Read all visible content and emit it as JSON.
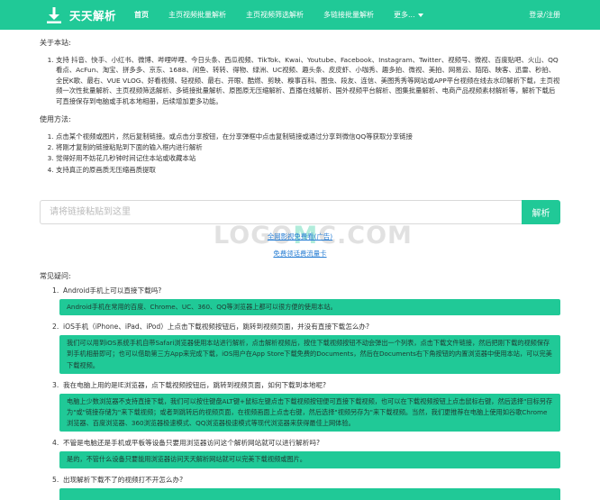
{
  "colors": {
    "brand": "#20c997",
    "link": "#2a7fd4"
  },
  "nav": {
    "brand_name": "天天解析",
    "brand_icon": "download-icon",
    "links": [
      "首页",
      "主页视频批量解析",
      "主页视频筛选解析",
      "多链接批量解析"
    ],
    "more_label": "更多...",
    "login_label": "登录/注册"
  },
  "about": {
    "title": "关于本站:",
    "items": [
      "支持 抖音、快手、小红书、微博、哔哩哔哩、今日头条、西瓜视频、TikTok、Kwai、Youtube、Facebook、Instagram、Twitter、视频号、微视、百度贴吧、火山、QQ看点、AcFun、淘宝、拼多多、京东、1688、闲鱼、转转、得物、绿洲、UC视频、趣头条、皮皮虾、小咖秀、趣多拍、微视、美拍、网易云、陌陌、映客、迅雷、秒拍、全民K歌、最右、VUE VLOG、好看视频、轻视频、最右、开眼、酷燃、剪映、糗事百科、图虫、段友、连信、美图秀秀等网站或APP平台视频在线去水印解析下载，主页视频一次性批量解析、主页视频筛选解析、多链接批量解析、原图原无压缩解析、直播在线解析、国外视频平台解析、图集批量解析、电商产品视频素材解析等，解析下载后可直接保存到电脑或手机本地相册，后续增加更多功能。"
    ]
  },
  "usage": {
    "title": "使用方法:",
    "items": [
      "点击某个视频或图片，然后复制链接。或点击分享按钮，在分享弹框中点击复制链接或通过分享到微信QQ等获取分享链接",
      "将刚才复制的链接粘贴到下面的输入框内进行解析",
      "觉得好用不妨花几秒钟时间记住本站或收藏本站",
      "支持真正的原画质无压缩画质提取"
    ]
  },
  "search": {
    "placeholder": "请将链接粘贴到这里",
    "button_label": "解析"
  },
  "links": {
    "video_link": "全网影视免费看(广告)",
    "traffic_link": "免费领话费流量卡"
  },
  "watermark": {
    "left": "LOGO",
    "mid": "M",
    "right": "C.COM"
  },
  "faq": {
    "title": "常见疑问:",
    "items": [
      {
        "q": "Android手机上可以直接下载吗?",
        "a": "Android手机在常用的百度、Chrome、UC、360、QQ等浏览器上都可以很方便的使用本站。"
      },
      {
        "q": "iOS手机（iPhone、iPad、iPod）上点击下载视频按钮后，跳转到视频页面，并没有直接下载怎么办?",
        "a": "我们可以用到iOS系统手机自带Safari浏览器使用本站进行解析，点击解析视频后，按住下载视频按钮不动会弹出一个列表，点击下载文件链接，然后把刚下载的视频保存到手机相册即可；也可以借助第三方App来完成下载，iOS用户在App Store下载免费的Documents，然后在Documents右下角按钮的内置浏览器中使用本站，可以完美下载视频。"
      },
      {
        "q": "我在电脑上用的是IE浏览器，点下载视频按钮后，跳转到视频页面，如何下载到本地呢?",
        "a": "电脑上少数浏览器不支持直接下载，我们可以按住键盘ALT键+鼠标左键点击下载视频按钮便可直接下载视频，也可以在下载视频按钮上点击鼠标右键，然后选择\"目标另存为\"或\"链接存储为\"来下载视频；或者到跳转后的视频页面，在视频画面上点击右键，然后选择\"视频另存为\"来下载视频。当然，我们更推荐在电脑上使用如谷歌Chrome浏览器、百度浏览器、360浏览器极速模式、QQ浏览器极速模式等现代浏览器来获得最佳上网体验。"
      },
      {
        "q": "不管是电脑还是手机或平板等设备只要用浏览器访问这个解析网站就可以进行解析吗?",
        "a": "是的，不管什么设备只要能用浏览器访问天天解析网站就可以完美下载视频或图片。"
      },
      {
        "q": "出现解析下载不了的视频打不开怎么办?",
        "a": ""
      }
    ]
  }
}
